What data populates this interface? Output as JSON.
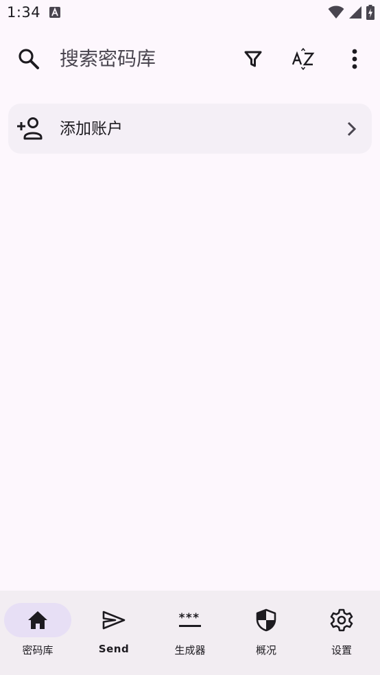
{
  "status_bar": {
    "time": "1:34",
    "icons": [
      "notification-a-icon",
      "wifi-icon",
      "signal-icon",
      "battery-charging-icon"
    ]
  },
  "toolbar": {
    "search_placeholder": "搜索密码库",
    "icons": [
      "search-icon",
      "filter-icon",
      "sort-az-icon",
      "more-vert-icon"
    ]
  },
  "add_account": {
    "label": "添加账户",
    "icon": "person-add-icon",
    "chevron": "chevron-right-icon"
  },
  "bottom_nav": {
    "items": [
      {
        "label": "密码库",
        "icon": "home-icon",
        "active": true
      },
      {
        "label": "Send",
        "icon": "send-icon",
        "active": false
      },
      {
        "label": "生成器",
        "icon": "generator-icon",
        "active": false
      },
      {
        "label": "概况",
        "icon": "shield-icon",
        "active": false
      },
      {
        "label": "设置",
        "icon": "gear-icon",
        "active": false
      }
    ]
  },
  "colors": {
    "background": "#fdf7fd",
    "card": "#f4eff6",
    "nav_background": "#f2edf2",
    "nav_active_indicator": "#e7dff5",
    "text": "#1d1b20"
  }
}
